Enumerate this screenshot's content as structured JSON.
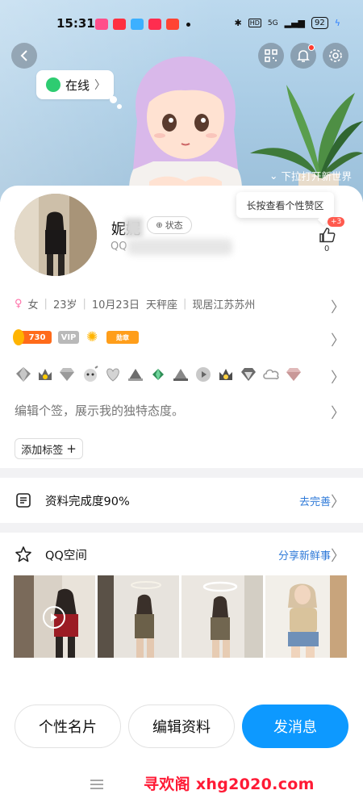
{
  "status_bar": {
    "time": "15:31",
    "network": "5G",
    "hd": "HD",
    "battery": "92"
  },
  "hero": {
    "online_status": "在线",
    "pull_hint": "下拉打开新世界"
  },
  "profile": {
    "name": "妮妮",
    "status_chip": "状态",
    "qq_label": "QQ",
    "like_tooltip": "长按查看个性赞区",
    "like_badge": "+3",
    "like_count": "0"
  },
  "info": {
    "gender": "女",
    "age": "23岁",
    "birthday": "10月23日",
    "zodiac": "天秤座",
    "location": "现居江苏苏州"
  },
  "badges": {
    "level": "730",
    "vip": "VIP",
    "extra": "勋章"
  },
  "signature_placeholder": "编辑个签，展示我的独特态度。",
  "add_tag_label": "添加标签",
  "completion": {
    "title": "资料完成度90%",
    "action": "去完善"
  },
  "qzone": {
    "title": "QQ空间",
    "action": "分享新鲜事"
  },
  "actions": {
    "card": "个性名片",
    "edit": "编辑资料",
    "message": "发消息"
  },
  "watermark": "寻欢阁 xhg2020.com",
  "colors": {
    "primary": "#0d99ff",
    "online": "#2ecc71",
    "link": "#2f7ad8",
    "badge_red": "#ff5a4e"
  }
}
